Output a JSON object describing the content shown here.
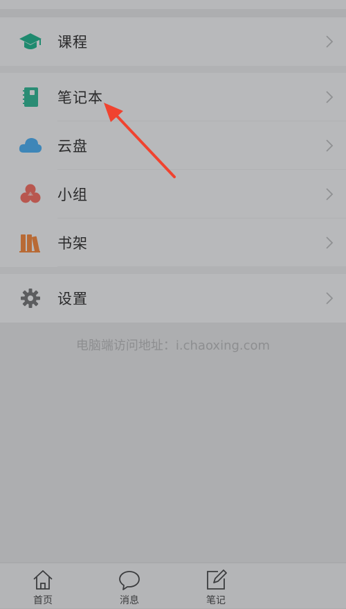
{
  "menu": {
    "course": {
      "label": "课程",
      "icon": "graduation-cap-icon",
      "color": "#1f8a6f"
    },
    "notebook": {
      "label": "笔记本",
      "icon": "notebook-icon",
      "color": "#2a8c74"
    },
    "cloud": {
      "label": "云盘",
      "icon": "cloud-icon",
      "color": "#3e86b8"
    },
    "group": {
      "label": "小组",
      "icon": "group-icon",
      "color": "#b8574f"
    },
    "bookshelf": {
      "label": "书架",
      "icon": "books-icon",
      "color": "#b86a35"
    },
    "settings": {
      "label": "设置",
      "icon": "gear-icon",
      "color": "#5c5d5f"
    }
  },
  "footer_note": "电脑端访问地址：i.chaoxing.com",
  "tabs": [
    {
      "label": "首页",
      "icon": "home-icon"
    },
    {
      "label": "消息",
      "icon": "chat-bubble-icon"
    },
    {
      "label": "笔记",
      "icon": "edit-note-icon"
    }
  ],
  "annotation_color": "#f0432f"
}
